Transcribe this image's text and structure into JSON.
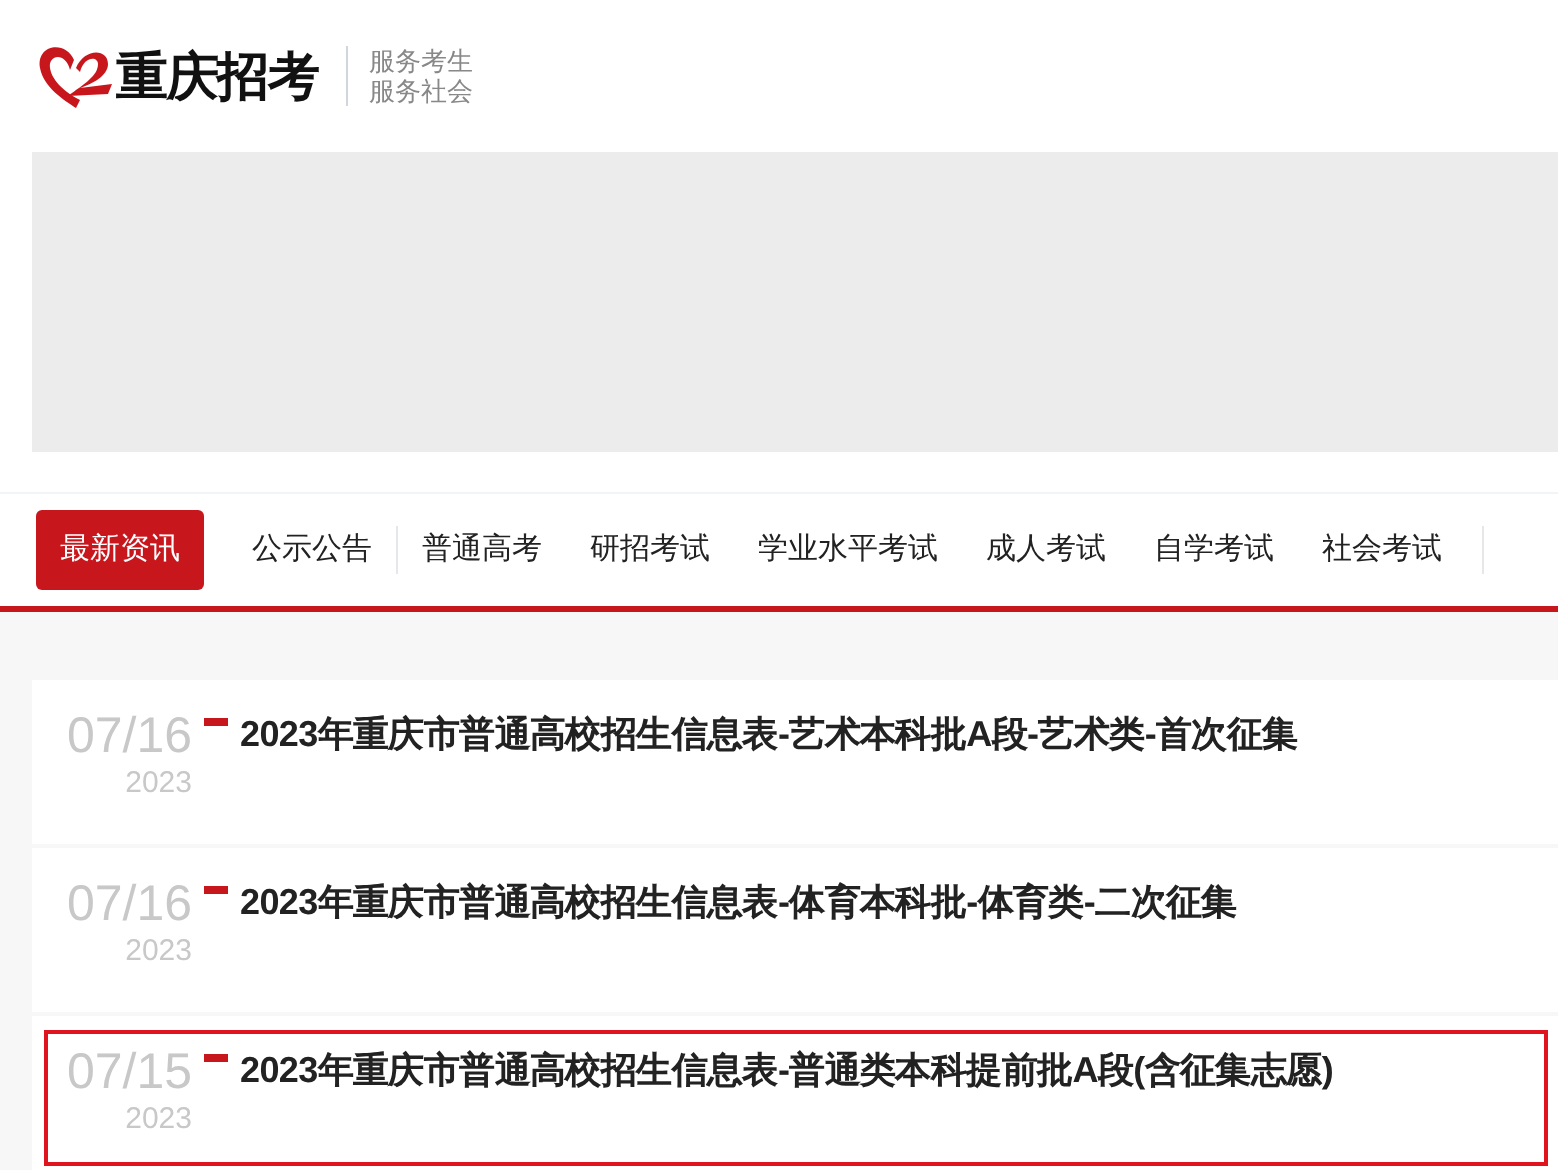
{
  "logo": {
    "title": "重庆招考",
    "slogan": [
      "服务考生",
      "服务社会"
    ]
  },
  "banner": {
    "kind": "empty"
  },
  "nav": [
    {
      "label": "最新资讯",
      "selected": true
    },
    {
      "label": "公示公告",
      "selected": false
    },
    {
      "label": "普通高考",
      "selected": false
    },
    {
      "label": "研招考试",
      "selected": false
    },
    {
      "label": "学业水平考试",
      "selected": false
    },
    {
      "label": "成人考试",
      "selected": false
    },
    {
      "label": "自学考试",
      "selected": false
    },
    {
      "label": "社会考试",
      "selected": false
    }
  ],
  "news": [
    {
      "date": "07/16",
      "year": "2023",
      "title": "2023年重庆市普通高校招生信息表-艺术本科批A段-艺术类-首次征集",
      "highlighted": false
    },
    {
      "date": "07/16",
      "year": "2023",
      "title": "2023年重庆市普通高校招生信息表-体育本科批-体育类-二次征集",
      "highlighted": false
    },
    {
      "date": "07/15",
      "year": "2023",
      "title": "2023年重庆市普通高校招生信息表-普通类本科提前批A段(含征集志愿)",
      "highlighted": true
    }
  ]
}
